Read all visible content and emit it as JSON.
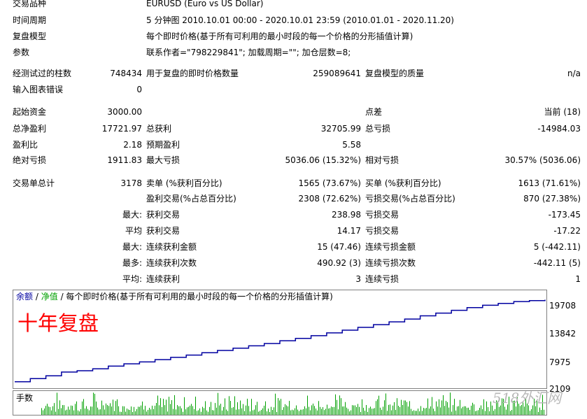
{
  "summary": {
    "symbol_label": "交易品种",
    "symbol_value": "EURUSD (Euro vs US Dollar)",
    "period_label": "时间周期",
    "period_value": "5 分钟图 2010.10.01 00:00 - 2020.10.01 23:59 (2010.01.01 - 2020.11.20)",
    "model_label": "复盘模型",
    "model_value": "每个即时价格(基于所有可利用的最小时段的每一个价格的分形插值计算)",
    "params_label": "参数",
    "params_value": "联系作者=\"798229841\"; 加载周期=\"\"; 加仓层数=8;"
  },
  "stats": {
    "bars_label": "经测试过的柱数",
    "bars_value": "748434",
    "ticks_label": "用于复盘的即时价格数量",
    "ticks_value": "259089641",
    "quality_label": "复盘模型的质量",
    "quality_value": "n/a",
    "errors_label": "输入图表错误",
    "errors_value": "0",
    "deposit_label": "起始资金",
    "deposit_value": "3000.00",
    "spread_label": "点差",
    "spread_value": "当前 (18)",
    "net_label": "总净盈利",
    "net_value": "17721.97",
    "gross_profit_label": "总获利",
    "gross_profit_value": "32705.99",
    "gross_loss_label": "总亏损",
    "gross_loss_value": "-14984.03",
    "pf_label": "盈利比",
    "pf_value": "2.18",
    "expected_label": "预期盈利",
    "expected_value": "5.58",
    "abs_dd_label": "绝对亏损",
    "abs_dd_value": "1911.83",
    "max_dd_label": "最大亏损",
    "max_dd_value": "5036.06 (15.32%)",
    "rel_dd_label": "相对亏损",
    "rel_dd_value": "30.57% (5036.06)",
    "trades_label": "交易单总计",
    "trades_value": "3178",
    "short_label": "卖单 (%获利百分比)",
    "short_value": "1565 (73.67%)",
    "long_label": "买单 (%获利百分比)",
    "long_value": "1613 (71.61%)",
    "profit_trades_label": "盈利交易(%占总百分比)",
    "profit_trades_value": "2308 (72.62%)",
    "loss_trades_label": "亏损交易(%占总百分比)",
    "loss_trades_value": "870 (27.38%)",
    "max1_prefix": "最大:",
    "largest_profit_label": "获利交易",
    "largest_profit_value": "238.98",
    "largest_loss_label": "亏损交易",
    "largest_loss_value": "-173.45",
    "avg1_prefix": "平均",
    "avg_profit_label": "获利交易",
    "avg_profit_value": "14.17",
    "avg_loss_label": "亏损交易",
    "avg_loss_value": "-17.22",
    "max2_prefix": "最大:",
    "consec_wins_money_label": "连续获利金额",
    "consec_wins_money_value": "15 (47.46)",
    "consec_losses_money_label": "连续亏损金额",
    "consec_losses_money_value": "5 (-442.11)",
    "most_prefix": "最多:",
    "consec_profit_label": "连续获利次数",
    "consec_profit_value": "490.92 (3)",
    "consec_loss_label": "连续亏损次数",
    "consec_loss_value": "-442.11 (5)",
    "avg2_prefix": "平均:",
    "avg_consec_wins_label": "连续获利",
    "avg_consec_wins_value": "3",
    "avg_consec_losses_label": "连续亏损",
    "avg_consec_losses_value": "1"
  },
  "chart": {
    "legend_balance": "余额",
    "legend_sep": "/",
    "legend_equity": "净值",
    "legend_model": "/ 每个即时价格(基于所有可利用的最小时段的每一个价格的分形插值计算)",
    "overlay_text": "十年复盘",
    "volume_label": "手数",
    "y_ticks": [
      "19708",
      "13842",
      "7975",
      "2109"
    ],
    "watermark": "518外汇网",
    "colors": {
      "balance": "#0000a0",
      "equity": "#00a000",
      "overlay": "#ff0000",
      "volume": "#00a000"
    }
  },
  "chart_data": {
    "type": "line",
    "title": "",
    "ylim": [
      2109,
      19708
    ],
    "series": [
      {
        "name": "余额",
        "values": [
          2900,
          3600,
          4200,
          5000,
          5300,
          5700,
          6300,
          6800,
          7200,
          7700,
          8200,
          8700,
          9200,
          9700,
          10200,
          10700,
          11200,
          11800,
          12300,
          12900,
          13500,
          14100,
          14700,
          15300,
          15900,
          16500,
          17200,
          17800,
          18400,
          19000,
          19500,
          19900,
          20300,
          20500,
          20700
        ]
      }
    ]
  }
}
